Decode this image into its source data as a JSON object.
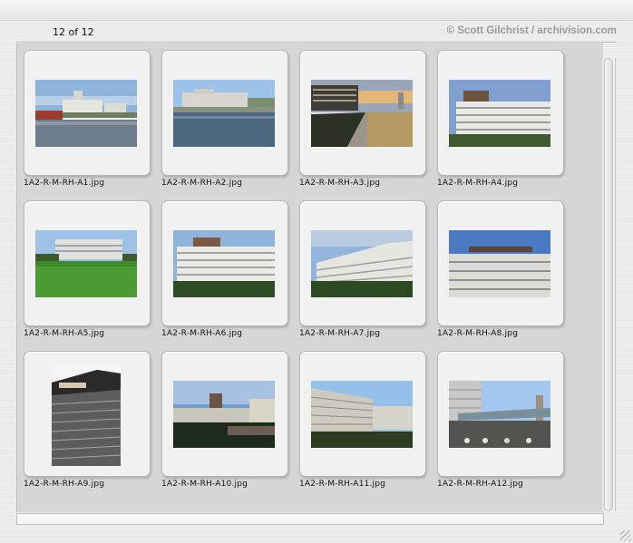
{
  "header": {
    "counter": "12 of 12",
    "credit": "© Scott Gilchrist / archivision.com"
  },
  "thumbnails": [
    {
      "filename": "1A2-R-M-RH-A1.jpg"
    },
    {
      "filename": "1A2-R-M-RH-A2.jpg"
    },
    {
      "filename": "1A2-R-M-RH-A3.jpg"
    },
    {
      "filename": "1A2-R-M-RH-A4.jpg"
    },
    {
      "filename": "1A2-R-M-RH-A5.jpg"
    },
    {
      "filename": "1A2-R-M-RH-A6.jpg"
    },
    {
      "filename": "1A2-R-M-RH-A7.jpg"
    },
    {
      "filename": "1A2-R-M-RH-A8.jpg"
    },
    {
      "filename": "1A2-R-M-RH-A9.jpg"
    },
    {
      "filename": "1A2-R-M-RH-A10.jpg"
    },
    {
      "filename": "1A2-R-M-RH-A11.jpg"
    },
    {
      "filename": "1A2-R-M-RH-A12.jpg"
    }
  ]
}
